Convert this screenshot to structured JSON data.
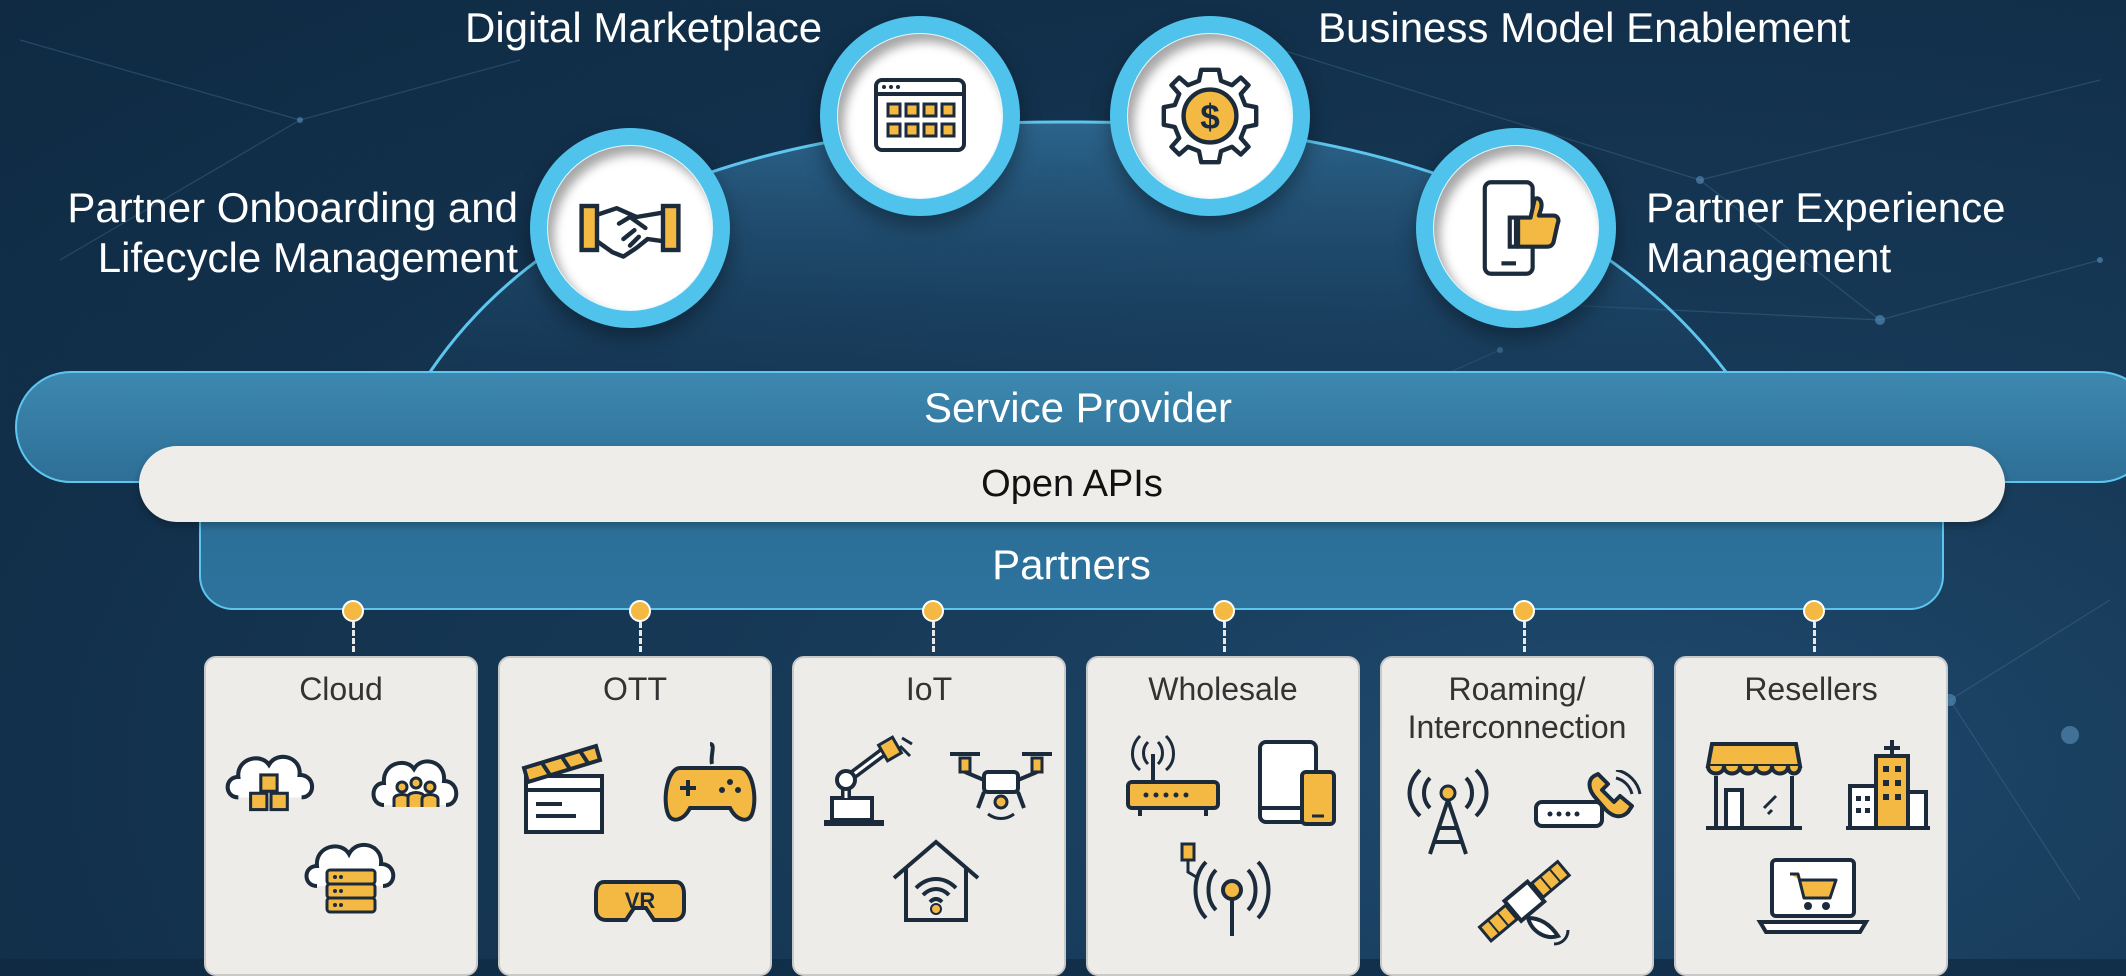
{
  "top_items": [
    {
      "label": "Partner Onboarding and Lifecycle Management",
      "lines": [
        "Partner Onboarding and",
        "Lifecycle Management"
      ],
      "icon": "handshake-icon"
    },
    {
      "label": "Digital Marketplace",
      "lines": [
        "Digital Marketplace"
      ],
      "icon": "marketplace-grid-icon"
    },
    {
      "label": "Business Model Enablement",
      "lines": [
        "Business Model Enablement"
      ],
      "icon": "dollar-gear-icon"
    },
    {
      "label": "Partner Experience Management",
      "lines": [
        "Partner Experience",
        "Management"
      ],
      "icon": "phone-thumbs-up-icon"
    }
  ],
  "service_provider": "Service Provider",
  "open_apis": "Open APIs",
  "partners": "Partners",
  "categories": [
    {
      "title": [
        "Cloud"
      ],
      "icons": [
        "cloud-cubes-icon",
        "cloud-people-icon",
        "cloud-server-icon"
      ]
    },
    {
      "title": [
        "OTT"
      ],
      "icons": [
        "clapperboard-icon",
        "gamepad-icon",
        "vr-headset-icon"
      ]
    },
    {
      "title": [
        "IoT"
      ],
      "icons": [
        "robot-arm-icon",
        "drone-icon",
        "smart-home-icon"
      ]
    },
    {
      "title": [
        "Wholesale"
      ],
      "icons": [
        "router-icon",
        "tablet-phone-icon",
        "antenna-signal-icon"
      ]
    },
    {
      "title": [
        "Roaming/",
        "Interconnection"
      ],
      "icons": [
        "radio-tower-icon",
        "phone-modem-icon",
        "satellite-icon"
      ]
    },
    {
      "title": [
        "Resellers"
      ],
      "icons": [
        "storefront-icon",
        "office-building-icon",
        "laptop-cart-icon"
      ]
    }
  ],
  "colors": {
    "accent": "#f4b942",
    "ring": "#4fc3ec",
    "navy": "#1c2b3c",
    "background": "#12304b"
  }
}
